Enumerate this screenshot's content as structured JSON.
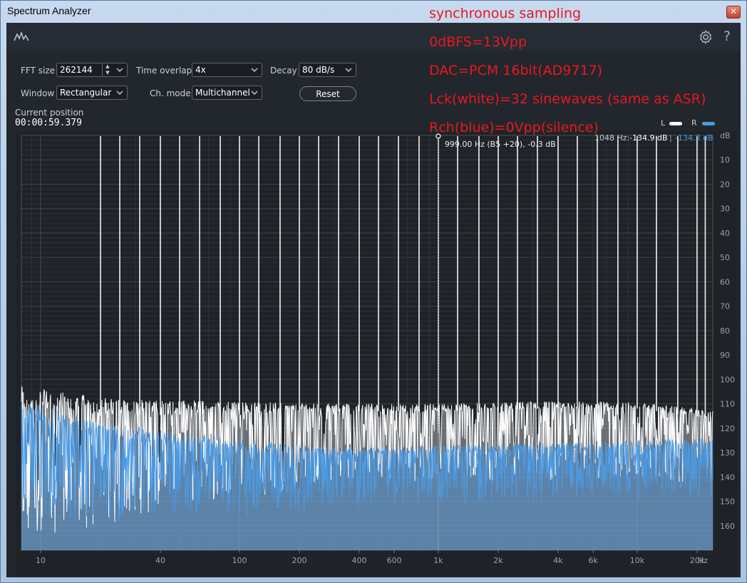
{
  "window": {
    "title": "Spectrum Analyzer",
    "close_label": "✕"
  },
  "toolbar": {
    "app_icon": "spectrum-icon",
    "settings_icon": "gear-icon",
    "help_label": "?"
  },
  "controls": {
    "fft_size_label": "FFT size",
    "fft_size_value": "262144",
    "time_overlap_label": "Time overlap",
    "time_overlap_value": "4x",
    "decay_label": "Decay",
    "decay_value": "80 dB/s",
    "window_label": "Window",
    "window_value": "Rectangular",
    "ch_mode_label": "Ch. mode",
    "ch_mode_value": "Multichannel",
    "reset_label": "Reset"
  },
  "position": {
    "label": "Current position",
    "value": "00:00:59.379"
  },
  "legend": {
    "left_label": "L",
    "right_label": "R"
  },
  "readout": {
    "freq": "1048 Hz:",
    "left_db": "-134.9 dB",
    "sep": "|",
    "right_db": "-134.3 dB"
  },
  "cursor": {
    "label": "999.00 Hz (B5 +20), -0.3 dB",
    "freq": 999
  },
  "annotations": [
    "synchronous sampling",
    "0dBFS=13Vpp",
    "DAC=PCM 16bit(AD9717)",
    "Lck(white)=32 sinewaves (same as ASR)",
    "Rch(blue)=0Vpp(silence)"
  ],
  "colors": {
    "left": "#ffffff",
    "right": "#4b9be6",
    "annotation": "#e8181e",
    "background": "#22272d"
  },
  "chart_data": {
    "type": "line",
    "x_scale": "log",
    "xlim": [
      8,
      24000
    ],
    "ylim": [
      -170,
      0
    ],
    "x_tick_labels": [
      "10",
      "40",
      "100",
      "200",
      "400",
      "600",
      "1k",
      "2k",
      "4k",
      "6k",
      "10k",
      "20k",
      "Hz"
    ],
    "x_tick_values": [
      10,
      40,
      100,
      200,
      400,
      600,
      1000,
      2000,
      4000,
      6000,
      10000,
      20000
    ],
    "x_unit_label": "Hz",
    "y_unit_label": "dB",
    "y_tick_labels": [
      "10",
      "20",
      "30",
      "40",
      "50",
      "60",
      "70",
      "80",
      "90",
      "100",
      "110",
      "120",
      "130",
      "140",
      "150",
      "160"
    ],
    "y_tick_values": [
      -10,
      -20,
      -30,
      -40,
      -50,
      -60,
      -70,
      -80,
      -90,
      -100,
      -110,
      -120,
      -130,
      -140,
      -150,
      -160
    ],
    "series": [
      {
        "name": "L",
        "peaks_hz": [
          20,
          25,
          31.5,
          40,
          50,
          63,
          80,
          100,
          125,
          160,
          200,
          250,
          315,
          400,
          500,
          630,
          800,
          1000,
          1250,
          1600,
          2000,
          2500,
          3150,
          4000,
          5000,
          6300,
          8000,
          10000,
          12500,
          16000,
          20000,
          22000
        ],
        "peak_db": -0.3,
        "floor_points": [
          [
            8,
            -112
          ],
          [
            20,
            -115
          ],
          [
            100,
            -114
          ],
          [
            300,
            -113
          ],
          [
            1000,
            -113
          ],
          [
            3000,
            -112
          ],
          [
            10000,
            -112
          ],
          [
            24000,
            -116
          ]
        ]
      },
      {
        "name": "R",
        "floor_points": [
          [
            8,
            -116
          ],
          [
            20,
            -124
          ],
          [
            50,
            -127
          ],
          [
            100,
            -129
          ],
          [
            300,
            -131
          ],
          [
            1000,
            -130
          ],
          [
            3000,
            -129
          ],
          [
            10000,
            -128
          ],
          [
            24000,
            -127
          ]
        ]
      }
    ]
  }
}
